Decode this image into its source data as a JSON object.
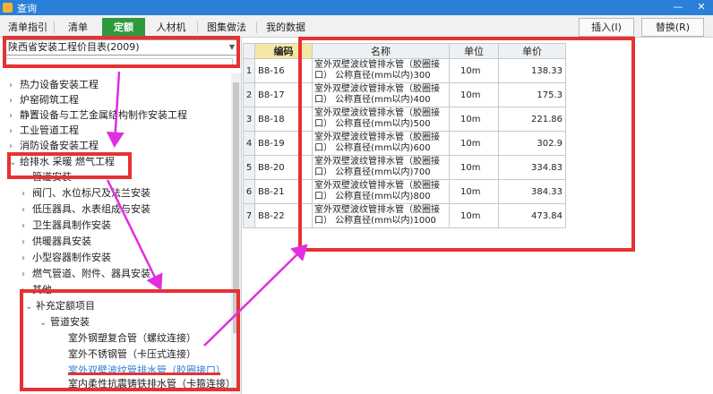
{
  "window": {
    "title": "查询",
    "minimize_glyph": "—",
    "close_glyph": "✕"
  },
  "tabs": [
    {
      "label": "清单指引",
      "active": false
    },
    {
      "label": "清单",
      "active": false
    },
    {
      "label": "定额",
      "active": true
    },
    {
      "label": "人材机",
      "active": false
    },
    {
      "label": "图集做法",
      "active": false
    },
    {
      "label": "我的数据",
      "active": false
    }
  ],
  "toolbar": {
    "insert_label": "插入(I)",
    "replace_label": "替换(R)"
  },
  "left": {
    "library_select": "陕西省安装工程价目表(2009)",
    "search_placeholder": "…",
    "tree": [
      {
        "label": "热力设备安装工程",
        "arrow": "›",
        "level": 0
      },
      {
        "label": "炉窑砌筑工程",
        "arrow": "›",
        "level": 0
      },
      {
        "label": "静置设备与工艺金属结构制作安装工程",
        "arrow": "›",
        "level": 0
      },
      {
        "label": "工业管道工程",
        "arrow": "›",
        "level": 0
      },
      {
        "label": "消防设备安装工程",
        "arrow": "›",
        "level": 0
      },
      {
        "label": "给排水 采暖 燃气工程",
        "arrow": "⌄",
        "level": 0
      },
      {
        "label": "管道安装",
        "arrow": "›",
        "level": 1
      },
      {
        "label": "阀门、水位标尺及法兰安装",
        "arrow": "›",
        "level": 1
      },
      {
        "label": "低压器具、水表组成与安装",
        "arrow": "›",
        "level": 1
      },
      {
        "label": "卫生器具制作安装",
        "arrow": "›",
        "level": 1
      },
      {
        "label": "供暖器具安装",
        "arrow": "›",
        "level": 1
      },
      {
        "label": "小型容器制作安装",
        "arrow": "›",
        "level": 1
      },
      {
        "label": "燃气管道、附件、器具安装",
        "arrow": "›",
        "level": 1
      },
      {
        "label": "其他",
        "arrow": "›",
        "level": 1
      },
      {
        "label": "补充定额项目",
        "arrow": "⌄",
        "level": 0
      },
      {
        "label": "管道安装",
        "arrow": "⌄",
        "level": 1
      },
      {
        "label": "室外钢塑复合管（螺纹连接）",
        "arrow": "",
        "level": 2
      },
      {
        "label": "室外不锈钢管（卡压式连接）",
        "arrow": "",
        "level": 2
      },
      {
        "label": "室外双壁波纹管排水管（胶圈接口）",
        "arrow": "",
        "level": 2,
        "selected": true
      },
      {
        "label": "室内柔性抗震铸铁排水管（卡箍连接）",
        "arrow": "",
        "level": 2
      }
    ]
  },
  "grid": {
    "headers": {
      "code": "编码",
      "name": "名称",
      "unit": "单位",
      "price": "单价"
    },
    "rows": [
      {
        "idx": "1",
        "code": "B8-16",
        "name": "室外双壁波纹管排水管（胶圈接口） 公称直径(mm以内)300",
        "unit": "10m",
        "price": "138.33"
      },
      {
        "idx": "2",
        "code": "B8-17",
        "name": "室外双壁波纹管排水管（胶圈接口） 公称直径(mm以内)400",
        "unit": "10m",
        "price": "175.3"
      },
      {
        "idx": "3",
        "code": "B8-18",
        "name": "室外双壁波纹管排水管（胶圈接口） 公称直径(mm以内)500",
        "unit": "10m",
        "price": "221.86"
      },
      {
        "idx": "4",
        "code": "B8-19",
        "name": "室外双壁波纹管排水管（胶圈接口） 公称直径(mm以内)600",
        "unit": "10m",
        "price": "302.9"
      },
      {
        "idx": "5",
        "code": "B8-20",
        "name": "室外双壁波纹管排水管（胶圈接口） 公称直径(mm以内)700",
        "unit": "10m",
        "price": "334.83"
      },
      {
        "idx": "6",
        "code": "B8-21",
        "name": "室外双壁波纹管排水管（胶圈接口） 公称直径(mm以内)800",
        "unit": "10m",
        "price": "384.33"
      },
      {
        "idx": "7",
        "code": "B8-22",
        "name": "室外双壁波纹管排水管（胶圈接口） 公称直径(mm以内)1000",
        "unit": "10m",
        "price": "473.84"
      }
    ]
  },
  "colors": {
    "titlebar": "#2a7fd8",
    "active_tab": "#2e9a3c",
    "annotation_red": "#e63232",
    "annotation_arrow": "#e02ee0",
    "selected_text": "#2a7fd8"
  }
}
